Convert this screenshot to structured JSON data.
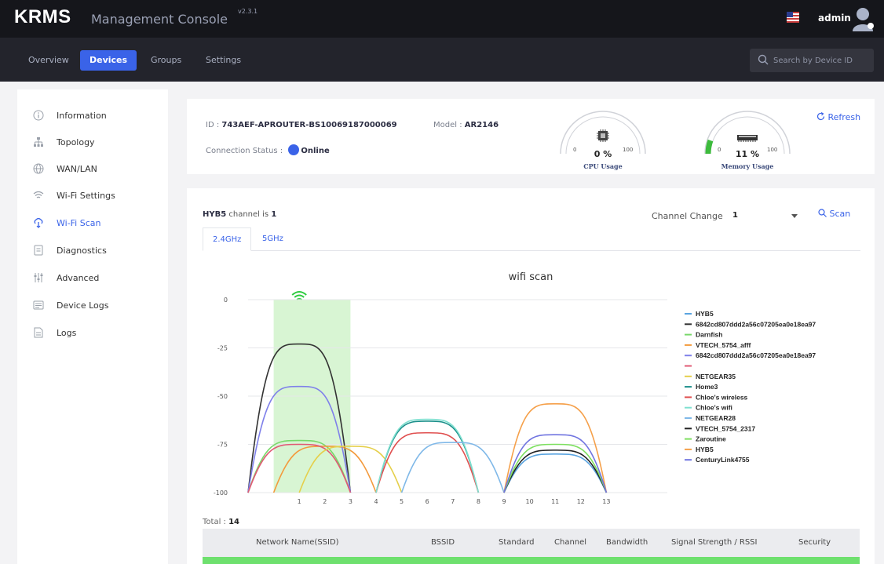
{
  "header": {
    "brand": "KRMS",
    "subtitle": "Management Console",
    "version": "v2.3.1",
    "user": "admin"
  },
  "nav": {
    "tabs": [
      "Overview",
      "Devices",
      "Groups",
      "Settings"
    ],
    "active": "Devices",
    "search_placeholder": "Search by Device ID"
  },
  "sidebar": {
    "items": [
      {
        "label": "Information",
        "icon": "info-icon"
      },
      {
        "label": "Topology",
        "icon": "topology-icon"
      },
      {
        "label": "WAN/LAN",
        "icon": "globe-icon"
      },
      {
        "label": "Wi-Fi Settings",
        "icon": "wifi-icon"
      },
      {
        "label": "Wi-Fi Scan",
        "icon": "wifi-scan-icon"
      },
      {
        "label": "Diagnostics",
        "icon": "diagnostics-icon"
      },
      {
        "label": "Advanced",
        "icon": "sliders-icon"
      },
      {
        "label": "Device Logs",
        "icon": "device-logs-icon"
      },
      {
        "label": "Logs",
        "icon": "logs-icon"
      }
    ],
    "active": "Wi-Fi Scan"
  },
  "device": {
    "id_label": "ID : ",
    "id": "743AEF-APROUTER-BS10069187000069",
    "model_label": "Model : ",
    "model": "AR2146",
    "status_label": "Connection Status : ",
    "status": "Online",
    "refresh_label": "Refresh",
    "cpu": {
      "label": "CPU Usage",
      "value_text": "0 %",
      "value": 0,
      "min": "0",
      "max": "100"
    },
    "memory": {
      "label": "Memory Usage",
      "value_text": "11 %",
      "value": 11,
      "min": "0",
      "max": "100"
    }
  },
  "scan": {
    "network": "HYB5",
    "channel_text": " channel is ",
    "channel": "1",
    "channel_change_label": "Channel Change",
    "channel_change_value": "1",
    "scan_label": "Scan",
    "tabs": [
      "2.4GHz",
      "5GHz"
    ],
    "active_tab": "2.4GHz",
    "total_label": "Total : ",
    "total": "14"
  },
  "table": {
    "columns": [
      "Network Name(SSID)",
      "BSSID",
      "Standard",
      "Channel",
      "Bandwidth",
      "Signal Strength / RSSI",
      "Security"
    ],
    "first_row_color": "#6ee06e"
  },
  "chart_data": {
    "type": "area",
    "title": "wifi scan",
    "x_ticks": [
      1,
      2,
      3,
      4,
      5,
      6,
      7,
      8,
      9,
      10,
      11,
      12,
      13
    ],
    "y_ticks": [
      0,
      -25,
      -50,
      -75,
      -100
    ],
    "ylim": [
      -100,
      0
    ],
    "highlight": {
      "channel_from": -1,
      "channel_to": 3,
      "color": "#d8f5d3",
      "marker_icon": "wifi-icon",
      "marker_channel": 1
    },
    "legend_position": "right",
    "series": [
      {
        "name": "HYB5",
        "center": 11,
        "peak": -80,
        "color": "#5aa4e0"
      },
      {
        "name": "6842cd807ddd2a56c07205ea0e18ea97",
        "center": 1,
        "peak": -23,
        "color": "#333333"
      },
      {
        "name": "Darnfish",
        "center": 1,
        "peak": -73,
        "color": "#78d86a"
      },
      {
        "name": "VTECH_5754_afff",
        "center": 2,
        "peak": -76,
        "color": "#f39a3c"
      },
      {
        "name": "6842cd807ddd2a56c07205ea0e18ea97",
        "center": 1,
        "peak": -45,
        "color": "#7f80ea"
      },
      {
        "name": "",
        "center": 1,
        "peak": -75,
        "color": "#e05a74"
      },
      {
        "name": "NETGEAR35",
        "center": 3,
        "peak": -76,
        "color": "#e5cf4a"
      },
      {
        "name": "Home3",
        "center": 6,
        "peak": -63,
        "color": "#1b8f8a"
      },
      {
        "name": "Chloe's wireless",
        "center": 6,
        "peak": -69,
        "color": "#e05050"
      },
      {
        "name": "Chloe's wifi",
        "center": 6,
        "peak": -62,
        "color": "#7fe0d0"
      },
      {
        "name": "NETGEAR28",
        "center": 7,
        "peak": -74,
        "color": "#7fb8e8"
      },
      {
        "name": "VTECH_5754_2317",
        "center": 11,
        "peak": -78,
        "color": "#222222"
      },
      {
        "name": "Zaroutine",
        "center": 11,
        "peak": -75,
        "color": "#7ee060"
      },
      {
        "name": "HYB5",
        "center": 11,
        "peak": -54,
        "color": "#f5a04a"
      },
      {
        "name": "CenturyLink4755",
        "center": 11,
        "peak": -70,
        "color": "#7074e0"
      }
    ]
  }
}
